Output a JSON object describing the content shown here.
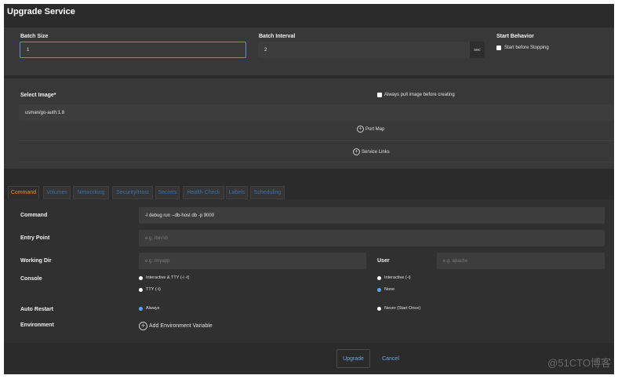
{
  "window": {
    "title": "Upgrade Service"
  },
  "batch": {
    "size_label": "Batch Size",
    "size_value": "1",
    "interval_label": "Batch Interval",
    "interval_value": "2",
    "interval_unit": "sec",
    "start_behavior_label": "Start Behavior",
    "start_before_stopping_label": "Start before Stopping"
  },
  "image": {
    "select_label": "Select Image*",
    "value": "usman/go-auth:1.8",
    "always_pull_label": "Always pull image before creating",
    "port_map_label": "Port Map",
    "service_links_label": "Service Links"
  },
  "tabs": [
    {
      "label": "Command"
    },
    {
      "label": "Volumes"
    },
    {
      "label": "Networking"
    },
    {
      "label": "Security/Host"
    },
    {
      "label": "Secrets"
    },
    {
      "label": "Health Check"
    },
    {
      "label": "Labels"
    },
    {
      "label": "Scheduling"
    }
  ],
  "command": {
    "command_label": "Command",
    "command_value": "-l debug run --db-host db -p 9000",
    "entry_point_label": "Entry Point",
    "entry_point_placeholder": "e.g. /bin/sh",
    "working_dir_label": "Working Dir",
    "working_dir_placeholder": "e.g. /myapp",
    "user_label": "User",
    "user_placeholder": "e.g. apache",
    "console_label": "Console",
    "console_options": [
      {
        "label": "Interactive & TTY (-i -t)",
        "selected": false
      },
      {
        "label": "Interactive (-i)",
        "selected": false
      },
      {
        "label": "TTY (-t)",
        "selected": false
      },
      {
        "label": "None",
        "selected": true
      }
    ],
    "auto_restart_label": "Auto Restart",
    "restart_options": [
      {
        "label": "Always",
        "selected": true
      },
      {
        "label": "Never (Start Once)",
        "selected": false
      }
    ],
    "environment_label": "Environment",
    "add_env_label": "Add Environment Variable"
  },
  "footer": {
    "upgrade_label": "Upgrade",
    "cancel_label": "Cancel"
  },
  "watermark": "@51CTO博客",
  "colors": {
    "accent": "#6aa6e8",
    "active_tab": "#f08a28",
    "radio_selected": "#5aa0f0"
  }
}
